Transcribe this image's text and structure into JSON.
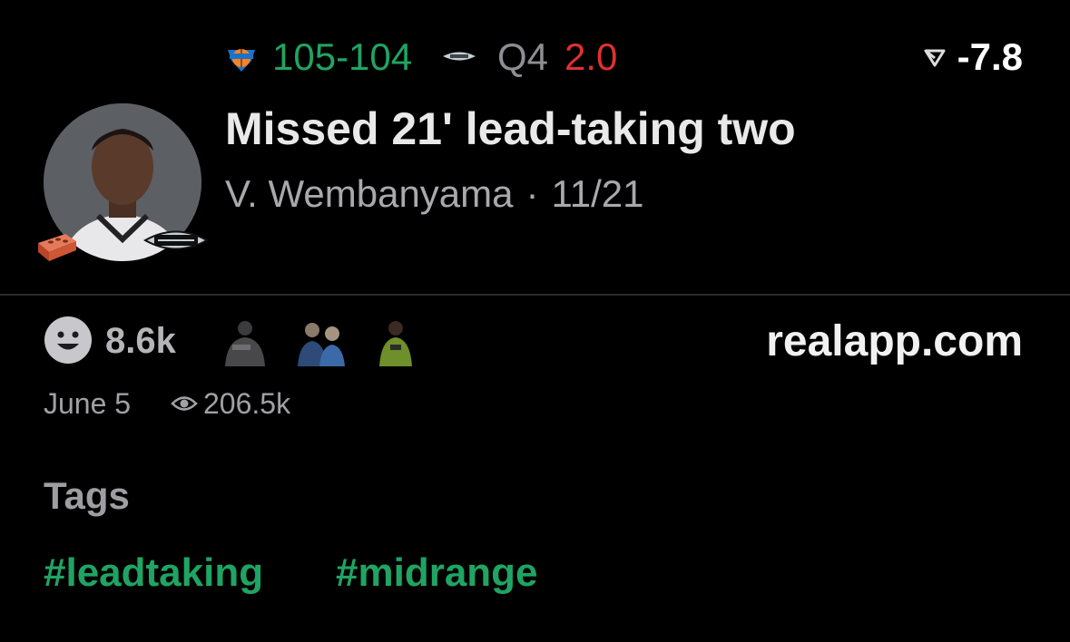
{
  "game": {
    "score": "105-104",
    "quarter": "Q4",
    "clock": "2.0",
    "rating": "-7.8",
    "colors": {
      "score": "#1fa463",
      "clock": "#e0312f",
      "quarter": "#8e8e93"
    },
    "home_icon": "knicks-logo-icon",
    "away_icon": "spurs-logo-icon"
  },
  "play": {
    "title": "Missed 21' lead-taking two",
    "player": "V. Wembanyama",
    "separator": "·",
    "game_date": "11/21"
  },
  "stats": {
    "reactions": "8.6k",
    "source": "realapp.com",
    "posted": "June 5",
    "views": "206.5k"
  },
  "tags": {
    "heading": "Tags",
    "items": [
      "#leadtaking",
      "#midrange"
    ],
    "color": "#1fa463"
  }
}
